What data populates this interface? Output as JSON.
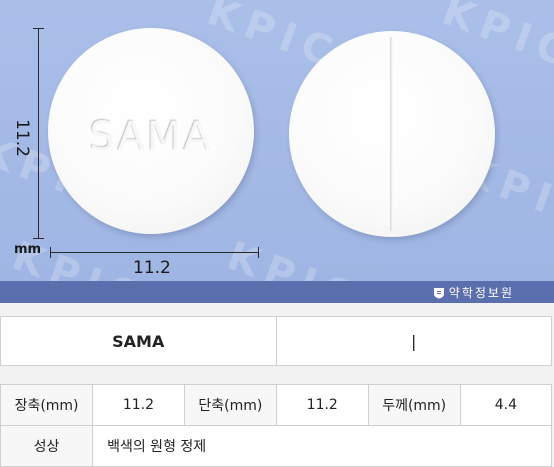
{
  "photo": {
    "watermark_text": "KPIC",
    "front_imprint": "SAMA",
    "back_imprint": "|",
    "dimension_vertical": "11.2",
    "dimension_horizontal": "11.2",
    "dimension_unit": "mm",
    "brand_text": "약학정보원",
    "brand_icon": "kpic-logo-icon"
  },
  "imprint_table": {
    "front": "SAMA",
    "back": "|"
  },
  "spec_table": {
    "major_axis_label": "장축(mm)",
    "major_axis_value": "11.2",
    "minor_axis_label": "단축(mm)",
    "minor_axis_value": "11.2",
    "thickness_label": "두께(mm)",
    "thickness_value": "4.4",
    "appearance_label": "성상",
    "appearance_value": "백색의 원형 정제"
  }
}
